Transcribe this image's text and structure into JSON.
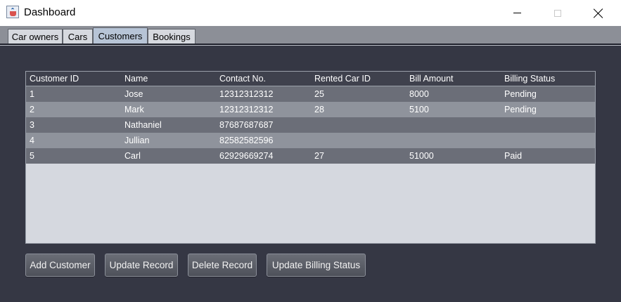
{
  "window": {
    "title": "Dashboard"
  },
  "tabs": [
    {
      "label": "Car owners"
    },
    {
      "label": "Cars"
    },
    {
      "label": "Customers"
    },
    {
      "label": "Bookings"
    }
  ],
  "active_tab": "Customers",
  "table": {
    "columns": [
      "Customer ID",
      "Name",
      "Contact No.",
      "Rented Car ID",
      "Bill Amount",
      "Billing Status"
    ],
    "rows": [
      [
        "1",
        "Jose",
        "12312312312",
        "25",
        "8000",
        "Pending"
      ],
      [
        "2",
        "Mark",
        "12312312312",
        "28",
        "5100",
        "Pending"
      ],
      [
        "3",
        "Nathaniel",
        "87687687687",
        "",
        "",
        ""
      ],
      [
        "4",
        "Jullian",
        "82582582596",
        "",
        "",
        ""
      ],
      [
        "5",
        "Carl",
        "62929669274",
        "27",
        "51000",
        "Paid"
      ]
    ]
  },
  "buttons": {
    "add": "Add Customer",
    "update": "Update Record",
    "delete": "Delete Record",
    "billing": "Update Billing Status"
  },
  "colors": {
    "panel_bg": "#353744",
    "header_bg": "#3f414d",
    "row_dark": "#6b6e78",
    "row_light": "#8f939c",
    "table_empty_bg": "#d5d8df",
    "active_tab": "#b7c4d6"
  },
  "icons": {
    "app": "java-cup-icon",
    "minimize": "minimize-icon",
    "maximize": "maximize-icon",
    "close": "close-icon"
  }
}
